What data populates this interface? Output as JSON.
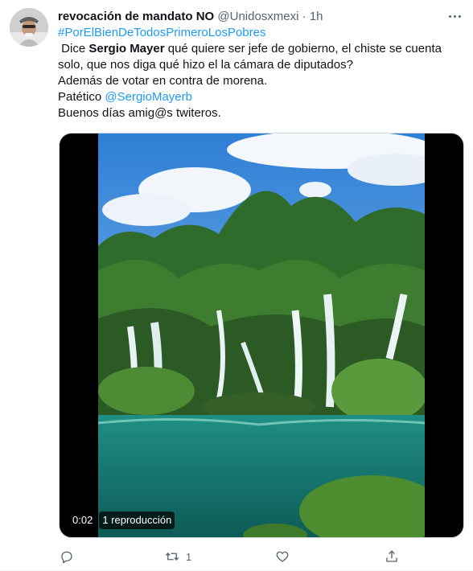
{
  "tweet": {
    "display_name": "revocación de mandato NO",
    "handle": "@Unidosxmexi",
    "separator": "·",
    "time": "1h",
    "hashtag": "#PorElBienDeTodosPrimeroLosPobres",
    "line1_prefix": " Dice ",
    "line1_mention": "Sergio Mayer",
    "line1_suffix": " qué quiere ser jefe de gobierno, el chiste se cuenta",
    "line2": "solo, que nos diga qué hizo el la cámara de diputados?",
    "line3": "Además de votar en contra de morena.",
    "line4_prefix": "Patético ",
    "line4_link": "@SergioMayerb",
    "line5": "Buenos días amig@s twiteros."
  },
  "media": {
    "duration": "0:02",
    "views": "1 reproducción"
  },
  "actions": {
    "reply_count": "",
    "retweet_count": "1",
    "like_count": "",
    "share_count": ""
  },
  "colors": {
    "link": "#1d9bf0",
    "secondary_text": "#536471",
    "primary_text": "#0f1419"
  }
}
